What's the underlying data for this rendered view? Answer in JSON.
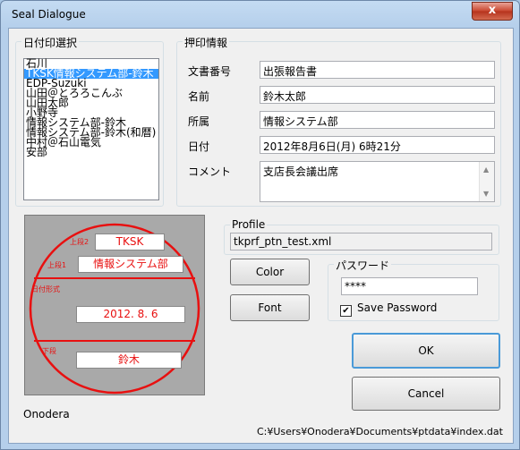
{
  "window": {
    "title": "Seal Dialogue",
    "close_glyph": "x"
  },
  "seal_select": {
    "label": "日付印選択",
    "items": [
      "石川",
      "TKSK情報システム部-鈴木",
      "EDP-Suzuki",
      "山田＠とろろこんぶ",
      "山田太郎",
      "小野寺",
      "情報システム部-鈴木",
      "情報システム部-鈴木(和暦)",
      "中村＠石山電気",
      "安部"
    ],
    "selected_index": 1
  },
  "stamp_info": {
    "label": "押印情報",
    "doc_number_label": "文書番号",
    "doc_number_value": "出張報告書",
    "name_label": "名前",
    "name_value": "鈴木太郎",
    "dept_label": "所属",
    "dept_value": "情報システム部",
    "date_label": "日付",
    "date_value": "2012年8月6日(月) 6時21分",
    "comment_label": "コメント",
    "comment_value": "支店長会議出席"
  },
  "seal": {
    "upper2_tag": "上段2",
    "upper2_text": "TKSK",
    "upper1_tag": "上段1",
    "upper1_text": "情報システム部",
    "date_tag": "日付形式",
    "date_text": "2012. 8. 6",
    "lower_tag": "下段",
    "lower_text": "鈴木",
    "seal_color": "#e81010"
  },
  "profile": {
    "label": "Profile",
    "value": "tkprf_ptn_test.xml"
  },
  "buttons": {
    "color": "Color",
    "font": "Font",
    "ok": "OK",
    "cancel": "Cancel"
  },
  "password": {
    "label": "パスワード",
    "value": "****",
    "save_label": "Save Password",
    "save_checked": true
  },
  "footer": {
    "user": "Onodera",
    "path": "C:¥Users¥Onodera¥Documents¥ptdata¥index.dat"
  }
}
